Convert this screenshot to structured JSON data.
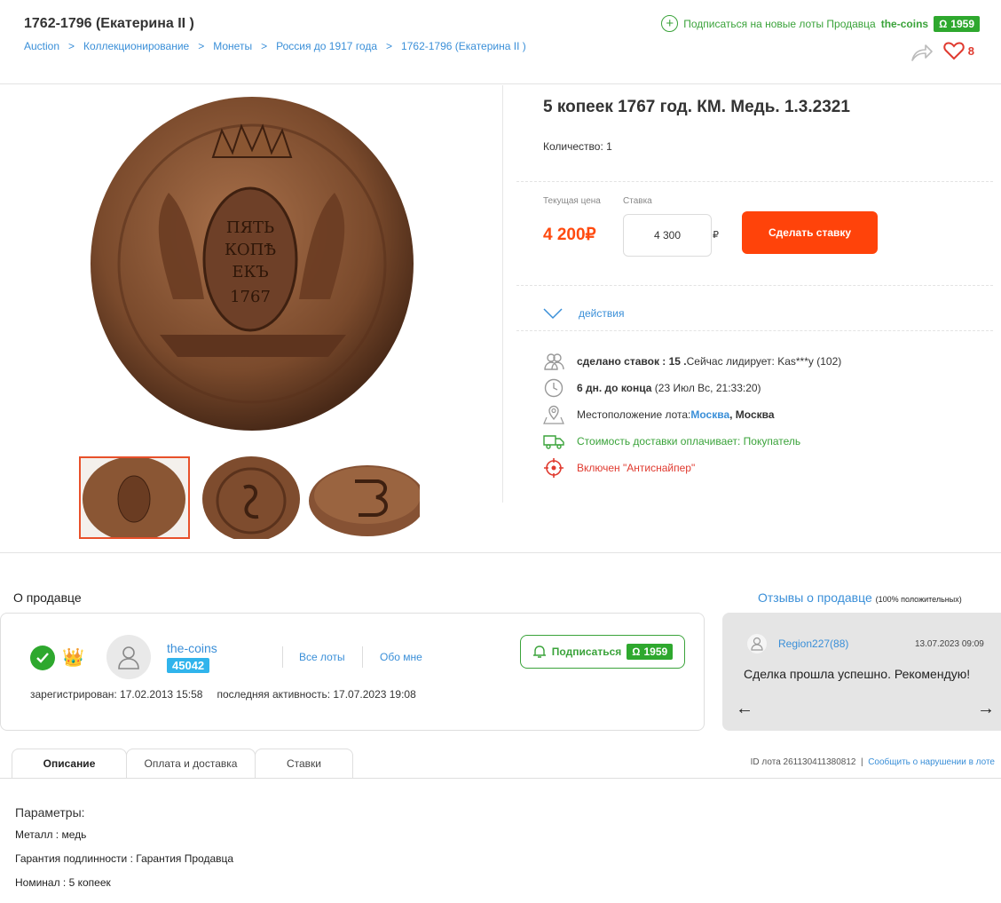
{
  "header": {
    "category_title": "1762-1796 (Екатерина II )",
    "breadcrumb": [
      "Auction",
      "Коллекционирование",
      "Монеты",
      "Россия до 1917 года",
      "1762-1796 (Екатерина II )"
    ],
    "subscribe_text": "Подписаться на новые лоты Продавца",
    "seller_name": "the-coins",
    "seller_rating": "1959",
    "likes": "8"
  },
  "lot": {
    "title": "5 копеек 1767 год. КМ. Медь. 1.3.2321",
    "quantity_label": "Количество: 1",
    "current_price_label": "Текущая цена",
    "current_price": "4 200₽",
    "bid_label": "Ставка",
    "bid_value": "4 300",
    "bid_currency": "₽",
    "bid_button": "Сделать ставку",
    "actions_label": "действия"
  },
  "info": {
    "bids_label": "сделано ставок : 15 .",
    "leader_text": "Сейчас лидирует: Kas***y (102)",
    "time_left": "6 дн. до конца",
    "end_date": "(23 Июл Вс, 21:33:20)",
    "location_label": "Местоположение лота:",
    "location_link": "Москва",
    "location_region": ", Москва",
    "shipping": "Стоимость доставки оплачивает: Покупатель",
    "antisniper": "Включен \"Антиснайпер\""
  },
  "seller": {
    "section_title": "О продавце",
    "name": "the-coins",
    "rating": "45042",
    "all_lots": "Все лоты",
    "about_me": "Обо мне",
    "subscribe_button": "Подписаться",
    "subscribers": "1959",
    "registered": "зарегистрирован: 17.02.2013 15:58",
    "last_activity": "последняя активность: 17.07.2023 19:08"
  },
  "reviews": {
    "title": "Отзывы о продавце",
    "positive_note": "(100% положительных)",
    "user": "Region227(88)",
    "date": "13.07.2023 09:09",
    "text": "Сделка прошла успешно. Рекомендую!"
  },
  "tabs": [
    "Описание",
    "Оплата и доставка",
    "Ставки"
  ],
  "lot_meta": {
    "id": "ID лота 261130411380812",
    "report": "Сообщить о нарушении в лоте"
  },
  "params": {
    "title": "Параметры:",
    "items": [
      "Металл : медь",
      "Гарантия подлинности : Гарантия Продавца",
      "Номинал : 5 копеек"
    ]
  },
  "colors": {
    "accent_orange": "#ff430a",
    "price_orange": "#ff4a0f",
    "link_blue": "#3a8fd8",
    "green": "#3aa33a",
    "rating_blue": "#30b4ec",
    "red": "#e03a2f"
  }
}
